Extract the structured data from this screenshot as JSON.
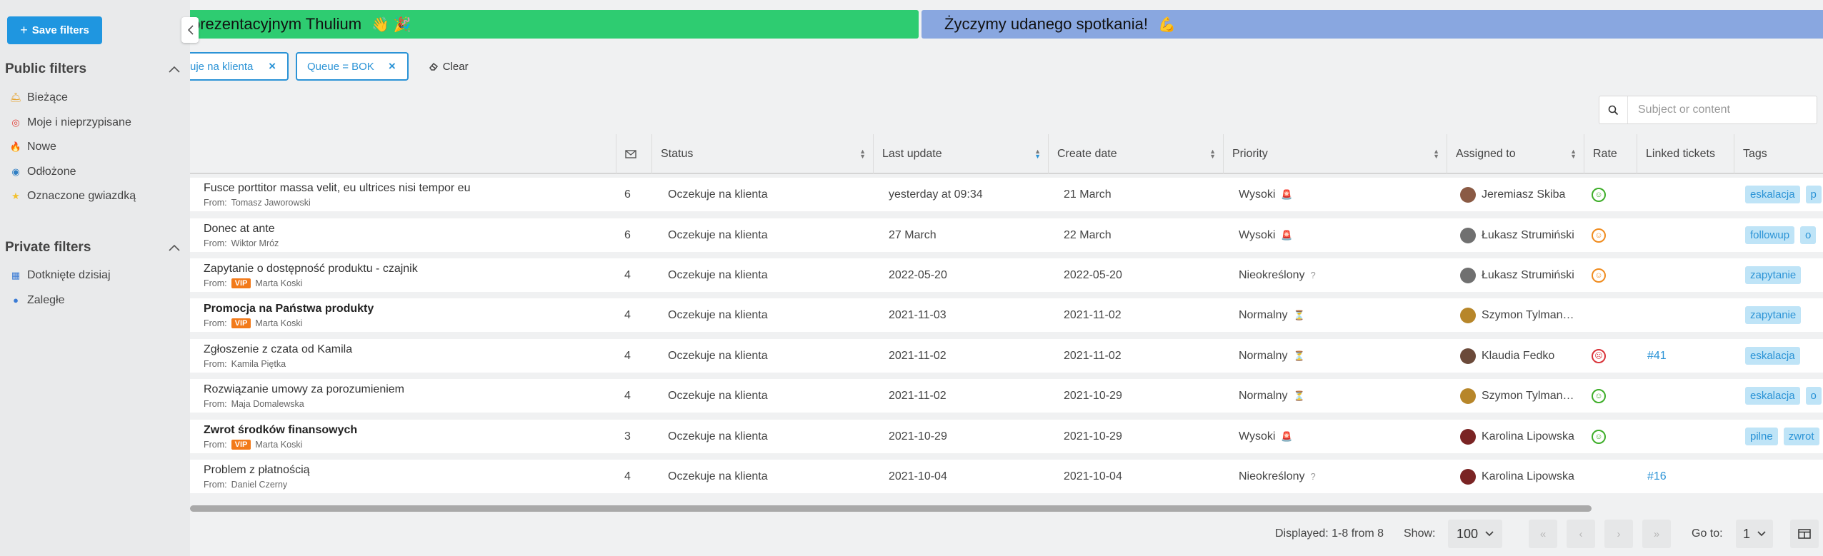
{
  "banners": {
    "left_text": "prezentacyjnym Thulium",
    "left_emoji": "👋 🎉",
    "right_text": "Życzymy udanego spotkania!",
    "right_emoji": "💪"
  },
  "filters_bar": {
    "chip1_label": "uje na klienta",
    "chip2_label": "Queue = BOK",
    "remove_symbol": "×",
    "clear_label": "Clear"
  },
  "search": {
    "placeholder": "Subject or content"
  },
  "columns": {
    "status": "Status",
    "last_update": "Last update",
    "create_date": "Create date",
    "priority": "Priority",
    "assigned": "Assigned to",
    "rate": "Rate",
    "linked": "Linked tickets",
    "tags": "Tags"
  },
  "rows": [
    {
      "subject": "Fusce porttitor massa velit, eu ultrices nisi tempor eu",
      "bold": false,
      "from_label": "From:",
      "vip": "",
      "from": "Tomasz Jaworowski",
      "count": "6",
      "status": "Oczekuje na klienta",
      "last_update": "yesterday at 09:34",
      "create_date": "21 March",
      "priority": "Wysoki",
      "priority_icon": "siren",
      "assigned": "Jeremiasz Skiba",
      "avatar_color": "#8a5a44",
      "rate": "good",
      "linked": "",
      "tags": [
        "eskalacja",
        "p"
      ]
    },
    {
      "subject": "Donec at ante",
      "bold": false,
      "from_label": "From:",
      "vip": "",
      "from": "Wiktor Mróz",
      "count": "6",
      "status": "Oczekuje na klienta",
      "last_update": "27 March",
      "create_date": "22 March",
      "priority": "Wysoki",
      "priority_icon": "siren",
      "assigned": "Łukasz Strumiński",
      "avatar_color": "#707070",
      "rate": "mid",
      "linked": "",
      "tags": [
        "followup",
        "o"
      ]
    },
    {
      "subject": "Zapytanie o dostępność produktu - czajnik",
      "bold": false,
      "from_label": "From:",
      "vip": "VIP",
      "from": "Marta Koski",
      "count": "4",
      "status": "Oczekuje na klienta",
      "last_update": "2022-05-20",
      "create_date": "2022-05-20",
      "priority": "Nieokreślony",
      "priority_icon": "question",
      "assigned": "Łukasz Strumiński",
      "avatar_color": "#707070",
      "rate": "mid",
      "linked": "",
      "tags": [
        "zapytanie"
      ]
    },
    {
      "subject": "Promocja na Państwa produkty",
      "bold": true,
      "from_label": "From:",
      "vip": "VIP",
      "from": "Marta Koski",
      "count": "4",
      "status": "Oczekuje na klienta",
      "last_update": "2021-11-03",
      "create_date": "2021-11-02",
      "priority": "Normalny",
      "priority_icon": "hourglass",
      "assigned": "Szymon Tylman…",
      "avatar_color": "#b7862a",
      "rate": "",
      "linked": "",
      "tags": [
        "zapytanie"
      ]
    },
    {
      "subject": "Zgłoszenie z czata od Kamila",
      "bold": false,
      "from_label": "From:",
      "vip": "",
      "from": "Kamila Piętka",
      "count": "4",
      "status": "Oczekuje na klienta",
      "last_update": "2021-11-02",
      "create_date": "2021-11-02",
      "priority": "Normalny",
      "priority_icon": "hourglass",
      "assigned": "Klaudia Fedko",
      "avatar_color": "#6b4a3a",
      "rate": "bad",
      "linked": "#41",
      "tags": [
        "eskalacja"
      ]
    },
    {
      "subject": "Rozwiązanie umowy za porozumieniem",
      "bold": false,
      "from_label": "From:",
      "vip": "",
      "from": "Maja Domalewska",
      "count": "4",
      "status": "Oczekuje na klienta",
      "last_update": "2021-11-02",
      "create_date": "2021-10-29",
      "priority": "Normalny",
      "priority_icon": "hourglass",
      "assigned": "Szymon Tylman…",
      "avatar_color": "#b7862a",
      "rate": "good",
      "linked": "",
      "tags": [
        "eskalacja",
        "o"
      ]
    },
    {
      "subject": "Zwrot środków finansowych",
      "bold": true,
      "from_label": "From:",
      "vip": "VIP",
      "from": "Marta Koski",
      "count": "3",
      "status": "Oczekuje na klienta",
      "last_update": "2021-10-29",
      "create_date": "2021-10-29",
      "priority": "Wysoki",
      "priority_icon": "siren",
      "assigned": "Karolina Lipowska",
      "avatar_color": "#7a2424",
      "rate": "good",
      "linked": "",
      "tags": [
        "pilne",
        "zwrot"
      ]
    },
    {
      "subject": "Problem z płatnością",
      "bold": false,
      "from_label": "From:",
      "vip": "",
      "from": "Daniel Czerny",
      "count": "4",
      "status": "Oczekuje na klienta",
      "last_update": "2021-10-04",
      "create_date": "2021-10-04",
      "priority": "Nieokreślony",
      "priority_icon": "question",
      "assigned": "Karolina Lipowska",
      "avatar_color": "#7a2424",
      "rate": "",
      "linked": "#16",
      "tags": []
    }
  ],
  "footer": {
    "displayed": "Displayed: 1-8 from 8",
    "show_label": "Show:",
    "show_value": "100",
    "goto_label": "Go to:",
    "goto_value": "1"
  },
  "sidebar": {
    "save_label": "Save filters",
    "public_title": "Public filters",
    "public_items": [
      {
        "label": "Bieżące",
        "icon": "fire-alarm-icon"
      },
      {
        "label": "Moje i nieprzypisane",
        "icon": "target-icon"
      },
      {
        "label": "Nowe",
        "icon": "flame-icon"
      },
      {
        "label": "Odłożone",
        "icon": "snooze-icon"
      },
      {
        "label": "Oznaczone gwiazdką",
        "icon": "star-icon"
      }
    ],
    "private_title": "Private filters",
    "private_items": [
      {
        "label": "Dotknięte dzisiaj",
        "icon": "calendar-icon"
      },
      {
        "label": "Zaległe",
        "icon": "magnifier-icon"
      }
    ]
  },
  "colors": {
    "accent": "#1f96e0",
    "banner_green": "#2ecc71",
    "banner_blue": "#89a7e0",
    "tag_bg": "#bfe4f7",
    "vip": "#f27a1a"
  }
}
